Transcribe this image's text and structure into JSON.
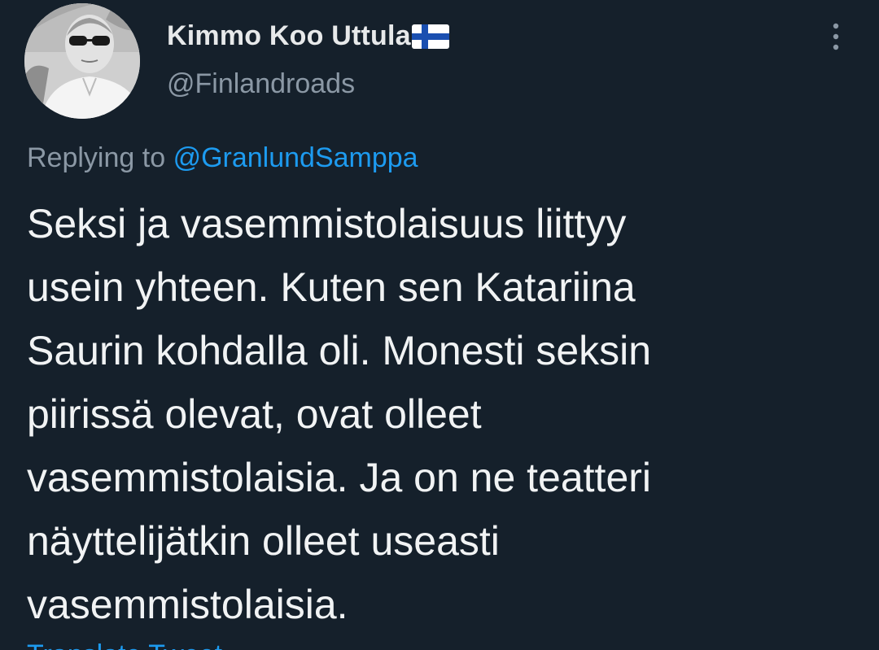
{
  "author": {
    "display_name": "Kimmo Koo Uttula",
    "flag_icon": "finland-flag-icon",
    "handle": "@Finlandroads"
  },
  "reply": {
    "prefix": "Replying to",
    "mention": "@GranlundSamppa"
  },
  "tweet": {
    "lines": [
      "Seksi ja vasemmistolaisuus liittyy",
      "usein yhteen. Kuten sen Katariina",
      "Saurin kohdalla oli. Monesti seksin",
      "piirissä olevat, ovat olleet",
      "vasemmistolaisia. Ja on ne teatteri",
      "näyttelijätkin olleet useasti",
      "vasemmistolaisia."
    ]
  },
  "translate_label": "Translate Tweet",
  "colors": {
    "background": "#15202b",
    "text": "#e7e9ea",
    "secondary": "#8b98a5",
    "accent": "#1d9bf0"
  },
  "icons": {
    "more": "more-options-icon"
  }
}
